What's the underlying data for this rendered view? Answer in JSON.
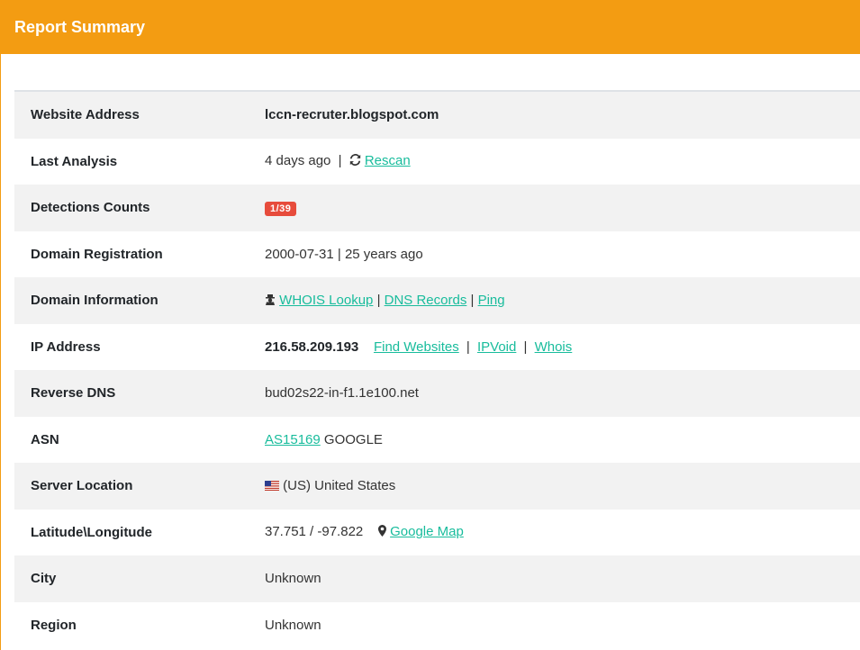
{
  "header": {
    "title": "Report Summary"
  },
  "rows": {
    "website": {
      "label": "Website Address",
      "value": "lccn-recruter.blogspot.com"
    },
    "last_analysis": {
      "label": "Last Analysis",
      "value": "4 days ago",
      "sep": "|",
      "rescan": "Rescan"
    },
    "detections": {
      "label": "Detections Counts",
      "badge": "1/39"
    },
    "domain_registration": {
      "label": "Domain Registration",
      "value": "2000-07-31 | 25 years ago"
    },
    "domain_information": {
      "label": "Domain Information",
      "whois": "WHOIS Lookup",
      "sep": "|",
      "dns": "DNS Records",
      "ping": "Ping"
    },
    "ip_address": {
      "label": "IP Address",
      "value": "216.58.209.193",
      "find": "Find Websites",
      "sep": "|",
      "ipvoid": "IPVoid",
      "whois": "Whois"
    },
    "reverse_dns": {
      "label": "Reverse DNS",
      "value": "bud02s22-in-f1.1e100.net"
    },
    "asn": {
      "label": "ASN",
      "link": "AS15169",
      "value": "GOOGLE"
    },
    "server_location": {
      "label": "Server Location",
      "value": "(US) United States"
    },
    "latlong": {
      "label": "Latitude\\Longitude",
      "value": "37.751 / -97.822",
      "map": "Google Map"
    },
    "city": {
      "label": "City",
      "value": "Unknown"
    },
    "region": {
      "label": "Region",
      "value": "Unknown"
    }
  },
  "colors": {
    "header": "#f39c12",
    "link": "#18bc9c",
    "badge": "#e74c3c"
  },
  "icons": {
    "rescan": "refresh-icon",
    "whois": "user-secret-icon",
    "flag": "us-flag-icon",
    "map": "map-marker-icon"
  }
}
